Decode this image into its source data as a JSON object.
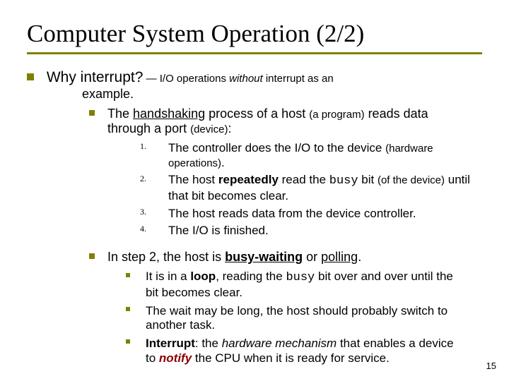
{
  "title": "Computer System Operation (2/2)",
  "q": {
    "lead": "Why interrupt?",
    "rest1": " — I/O operations ",
    "without": "without",
    "rest2": " interrupt as an",
    "cont": "example."
  },
  "hs": {
    "a": "The ",
    "handshaking": "handshaking",
    "b": " process of a host ",
    "paren1": "(a program)",
    "c": " reads data",
    "d": "through a port ",
    "paren2": "(device)",
    "colon": ":"
  },
  "steps": {
    "n1": "1.",
    "s1a": "The controller does the I/O to the device ",
    "s1b": "(hardware",
    "s1c": "operations)",
    "s1d": ".",
    "n2": "2.",
    "s2a": "The host ",
    "s2b": "repeatedly",
    "s2c": " read the ",
    "s2d": "busy",
    "s2e": " bit ",
    "s2f": "(of the device)",
    "s2g": " until",
    "s2h": "that bit becomes clear.",
    "n3": "3.",
    "s3": "The host reads data from the device controller.",
    "n4": "4.",
    "s4": "The I/O is finished."
  },
  "p2": {
    "a": "In step 2, the host is ",
    "bw": "busy-waiting",
    "b": " or ",
    "poll": "polling",
    "c": "."
  },
  "b1": {
    "a": "It is in a ",
    "loop": "loop",
    "b": ", reading the ",
    "busy": "busy",
    "c": " bit over and over until the",
    "d": "bit becomes clear."
  },
  "b2": {
    "a": "The wait may be long, the host should probably switch to",
    "b": "another task."
  },
  "b3": {
    "int": "Interrupt",
    "a": ": the ",
    "hw": "hardware mechanism",
    "b": " that enables a device",
    "c": "to ",
    "notify": "notify",
    "d": " the CPU when it is ready for service."
  },
  "page": "15"
}
